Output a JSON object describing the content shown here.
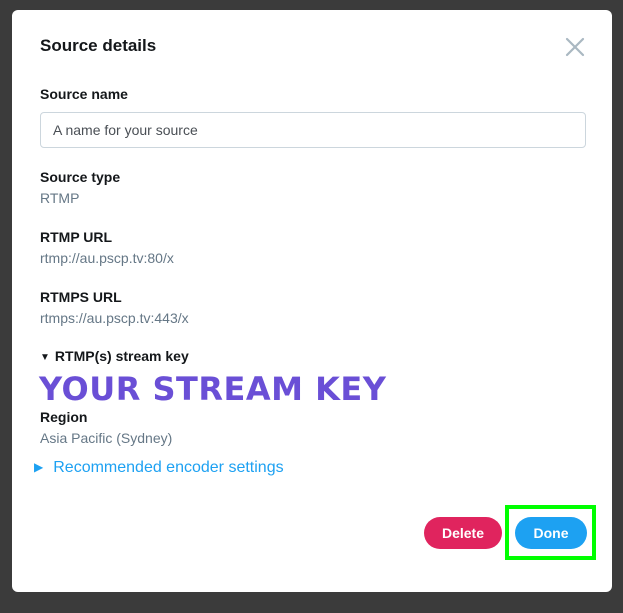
{
  "dialog": {
    "title": "Source details",
    "close_icon": "close-icon"
  },
  "source_name": {
    "label": "Source name",
    "placeholder": "A name for your source",
    "value": ""
  },
  "source_type": {
    "label": "Source type",
    "value": "RTMP"
  },
  "rtmp_url": {
    "label": "RTMP URL",
    "value": "rtmp://au.pscp.tv:80/x"
  },
  "rtmps_url": {
    "label": "RTMPS URL",
    "value": "rtmps://au.pscp.tv:443/x"
  },
  "stream_key": {
    "label": "RTMP(s) stream key",
    "expanded": true,
    "value": "YOUR STREAM KEY"
  },
  "region": {
    "label": "Region",
    "value": "Asia Pacific (Sydney)"
  },
  "encoder_settings": {
    "label": "Recommended encoder settings",
    "expanded": false
  },
  "actions": {
    "delete_label": "Delete",
    "done_label": "Done"
  },
  "colors": {
    "accent": "#1da1f2",
    "danger": "#e0245e",
    "stream_key": "#6a4fd6",
    "highlight": "#00ff00",
    "backdrop": "#3b3b3b"
  }
}
